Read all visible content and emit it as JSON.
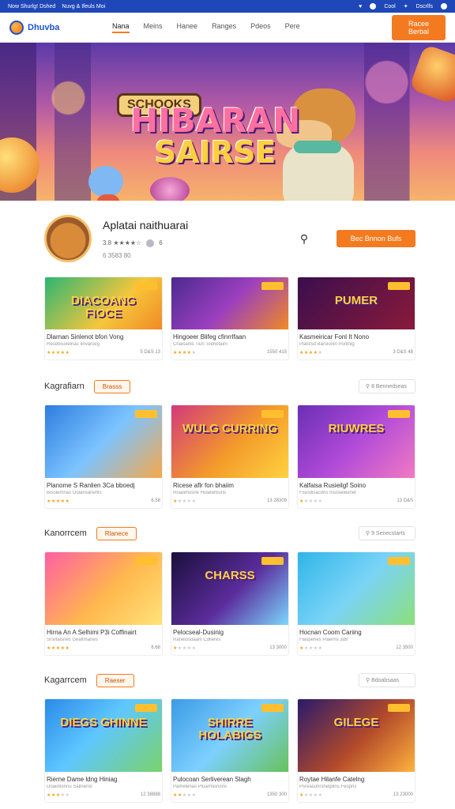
{
  "topbar": {
    "left": [
      "Now Shurlg! Dshed",
      "Nuvg & Ifeuls Moi"
    ],
    "right": [
      "♥",
      "Cool",
      "✦",
      "Dscrlfs"
    ]
  },
  "nav": {
    "logo_text": "Dhuvba",
    "items": [
      "Nana",
      "Meins",
      "Hanee",
      "Ranges",
      "Pdeos",
      "Pere"
    ],
    "active_index": 0,
    "cta_label": "Racee Berbal"
  },
  "hero": {
    "sign_text": "SCHOOKS",
    "letter_a": "A",
    "title_line1": "HIBARAN",
    "title_line2": "SAIRSE"
  },
  "profile": {
    "name": "Aplatai naithuarai",
    "rating_text": "3.8 ★★★★☆",
    "meta_count": "6",
    "sub_text": "6 3583 80",
    "search_icon": "search-icon",
    "follow_label": "Bec Bnnon Bufs"
  },
  "featured": [
    {
      "title": "Dlarnan Sinlenot bfon Vong",
      "subtitle": "Resebisolelnas Iinvaroeg",
      "rating": 4.5,
      "stats": "5 D&S 13",
      "thumb_text": "DIACOANG FIOCE",
      "bg": "linear-gradient(135deg,#2bb673,#f6c63b 60%,#f08a24)"
    },
    {
      "title": "Hingoeer Blifeg cfinrrlfaan",
      "subtitle": "Chalsartis Tiun Toehetaim",
      "rating": 3.5,
      "stats": "1550 415",
      "thumb_text": "",
      "bg": "linear-gradient(135deg,#4b2a8f,#9b3fbf 50%,#f08a24)"
    },
    {
      "title": "Kasmeiricar Fonl It Nono",
      "subtitle": "Plalsfsd Barslonin Pontnlg",
      "rating": 3.5,
      "stats": "3 D&S 48",
      "thumb_text": "PUMER",
      "bg": "linear-gradient(135deg,#3a0f4d,#8a1a3a)"
    }
  ],
  "sections": [
    {
      "title": "Kagrafiarn",
      "tag": "Brasss",
      "more": "8 Bennedseas",
      "cards": [
        {
          "title": "Planome S Ranlien 3Ca bboedj",
          "subtitle": "Bisolemnas Oolansanehts",
          "rating": 5,
          "stats": "6.58",
          "thumb_text": "",
          "bg": "linear-gradient(135deg,#2e7de0,#7cc4ff 50%,#f6a84a)"
        },
        {
          "title": "Ricese aflr fon bhaiim",
          "subtitle": "Roialimosne Holaterbuns",
          "rating": 1,
          "stats": "13 28309",
          "thumb_text": "WULG CURRING",
          "bg": "linear-gradient(135deg,#d33a7a,#f39a2a 55%,#ffd23f)"
        },
        {
          "title": "Kalfaisa Rusieilgf Soino",
          "subtitle": "Fisiodisacdns Inssseleonet",
          "rating": 1,
          "stats": "13 D&S",
          "thumb_text": "RIUWRES",
          "bg": "linear-gradient(135deg,#6a2fb3,#b04ad9 50%,#f17ac2)"
        }
      ]
    },
    {
      "title": "Kanorrcem",
      "tag": "Rlanece",
      "more": "9 Senecstarts",
      "cards": [
        {
          "title": "Hirna An A Selhimi P3i Coffinairt",
          "subtitle": "Srsiitalsnes Gealtmanes",
          "rating": 5,
          "stats": "6.68",
          "thumb_text": "",
          "bg": "linear-gradient(135deg,#ff5fa2,#ffb84d 55%,#ffe27a)"
        },
        {
          "title": "Pelocseal-Dusinig",
          "subtitle": "Ranelosdaanl Cdlieres",
          "rating": 1,
          "stats": "13 3000",
          "thumb_text": "CHARSS",
          "bg": "linear-gradient(135deg,#1b0f3d,#5b2d9c 55%,#7bd8ff)"
        },
        {
          "title": "Hocnan Coom Cariing",
          "subtitle": "Flaspenes Piaerns 3d9",
          "rating": 1,
          "stats": "12 3500",
          "thumb_text": "",
          "bg": "linear-gradient(135deg,#2fb5e8,#7ad3f7 50%,#8ce07a)"
        }
      ]
    },
    {
      "title": "Kagarrcem",
      "tag": "Raeser",
      "more": "Bdoabsaas",
      "cards": [
        {
          "title": "Rierne Dame ldng Hiniag",
          "subtitle": "Doaiinlonnu Sallnensl",
          "rating": 3,
          "stats": "12 38888",
          "thumb_text": "DIEGS GHINNE",
          "bg": "linear-gradient(135deg,#2b8ae8,#5ec7ff 45%,#7bd36a)"
        },
        {
          "title": "Pulocoan Serliverean Slagh",
          "subtitle": "Pamelenas Ploarmisnons",
          "rating": 2,
          "stats": "1350 300",
          "thumb_text": "SHIRRE HOLABIGS",
          "bg": "linear-gradient(135deg,#3c9be5,#7dd0ff 50%,#67c25a)"
        },
        {
          "title": "Roytae Hilanfe Catelng",
          "subtitle": "Psreasonrshelpilns Feopns",
          "rating": 1,
          "stats": "13 23000",
          "thumb_text": "GILEGE",
          "bg": "linear-gradient(135deg,#2a1a6b,#b34a2a 55%,#ffb23f)"
        }
      ]
    }
  ]
}
